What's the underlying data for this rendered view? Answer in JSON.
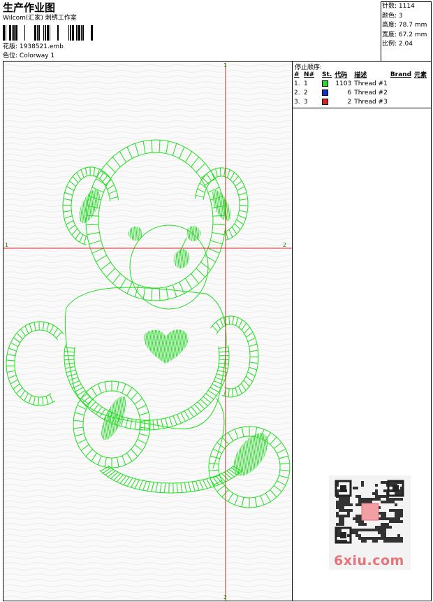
{
  "header": {
    "title": "生产作业图",
    "company": "Wilcom(汇家) 刺绣工作室",
    "design_label": "花版:",
    "design_value": "1938521.emb",
    "colorway_label": "色位:",
    "colorway_value": "Colorway 1"
  },
  "stats": [
    {
      "label": "针数:",
      "value": "1114"
    },
    {
      "label": "颜色:",
      "value": "3"
    },
    {
      "label": "高度:",
      "value": "78.7 mm"
    },
    {
      "label": "宽度:",
      "value": "67.2 mm"
    },
    {
      "label": "比例:",
      "value": "2.04"
    }
  ],
  "stop_sequence": {
    "title": "停止顺序:",
    "columns": [
      "#",
      "N#",
      "St.",
      "代码",
      "描述",
      "Brand",
      "元素"
    ],
    "rows": [
      {
        "num": "1.",
        "n": "1",
        "color": "#22dd22",
        "stitches": "1103",
        "desc": "Thread #1"
      },
      {
        "num": "2.",
        "n": "2",
        "color": "#1030d0",
        "stitches": "6",
        "desc": "Thread #2"
      },
      {
        "num": "3.",
        "n": "3",
        "color": "#e02020",
        "stitches": "2",
        "desc": "Thread #3"
      }
    ]
  },
  "crosshair": {
    "vertical_top_label": "1",
    "vertical_bottom_label": "2",
    "horizontal_left_label": "1",
    "horizontal_right_label": "2",
    "color": "#e02020"
  },
  "design": {
    "stitch_color": "#22dd22"
  },
  "watermark": {
    "text": "6xiu.com",
    "color": "#e8747a"
  }
}
